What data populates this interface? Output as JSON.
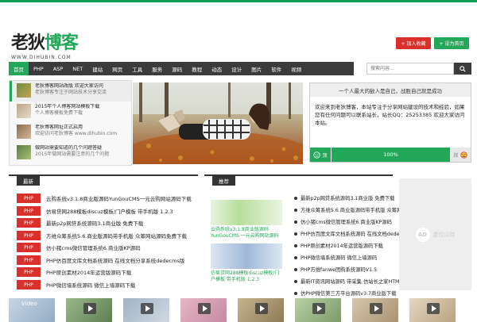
{
  "logo": {
    "chars": [
      "老",
      "狄",
      "博",
      "客"
    ],
    "sub": "WWW.DIHUBIN.COM"
  },
  "header_buttons": [
    {
      "label": "+ 加入收藏",
      "color": "#d9302c"
    },
    {
      "label": "+ 设为首页",
      "color": "#23a85a"
    }
  ],
  "nav": [
    "首页",
    "PHP",
    "ASP",
    "NET",
    "建站",
    "网页",
    "工具",
    "服务",
    "源码",
    "教程",
    "动态",
    "设计",
    "图片",
    "软件",
    "视频"
  ],
  "search": {
    "placeholder": "搜索内容..."
  },
  "featured": [
    {
      "title": "老狄博客网站改版 欢迎大家访问",
      "sub": "老狄博客专注于网站技术分享交流"
    },
    {
      "title": "2015年个人博客网站模板下载",
      "sub": "个人博客模板免费下载"
    },
    {
      "title": "老狄博客网址正式启用",
      "sub": "欢迎访问老狄博客 www.dihubin.com"
    },
    {
      "title": "做网站需要知道的几个问题答疑",
      "sub": "2015年做网站需要注意的几个问题"
    }
  ],
  "quote": {
    "title": "一个人最大的敌人是自己，战胜自己就是成功",
    "text": "欢迎来到老狄博客，本站专注于分享网站建设的技术和经验，如果您有任何问题可以联系站长，站长QQ：25253385  欢迎大家访问本站。",
    "left_icon": "smile-icon",
    "percent": "100%",
    "right_icon": "frown-icon",
    "left_label": "顶",
    "right_label": "踩"
  },
  "list1": {
    "heading": "最新",
    "tag": "PHP",
    "items": [
      "云购系统v3.1.8商业版源码YunGouCMS一元云购网站源码下载",
      "仿易贷网288模板discuz模板/门户模板 带手机版 1.2.3",
      "最新p2p网贷系统源码3.1商业版 免费下载",
      "方维众筹系统5.6.商业版源码带手机版 众筹网站源码免费下载",
      "仿小猪cms微信管理系统6.商业版KP源码",
      "PHP仿百度文库文档系统源码 在线文档分享系统dedecms版",
      "PHP原创素材2014年运营版源码下载",
      "PHP微信墙系统源码 微信上墙源码下载"
    ]
  },
  "list2": {
    "heading": "推荐",
    "cards": [
      {
        "caption": "云购系统v3.1.8商业版源码YunGouCMS 一元云购网站源码"
      },
      {
        "caption": "仿易贷网288模板discuz模板/门户模板 带手机版 1.2.3"
      }
    ],
    "items": [
      "最新p2p网贷系统源码3.1商业版 免费下载",
      "方维众筹系统5.6.商业版源码带手机版 众筹网站源码",
      "仿小猪cms微信管理系统6.商业版KP源码",
      "PHP仿百度文库文档系统源码 在线文档dedecms版",
      "PHP原创素材2014年运营版源码下载",
      "PHP微信墙系统源码 微信上墙源码",
      "PHP方维fanwe团购系统源码V1.5",
      "最新IT资讯网站源码 带采集 仿站长之家HTML版",
      "仿PHP微信第三方平台源码v3.7商业版下载"
    ]
  },
  "ad": {
    "badge": "AD",
    "text": "虚位以待"
  },
  "videos": [
    "video-1",
    "video-2",
    "video-3",
    "video-4",
    "video-5",
    "video-6",
    "video-7",
    "video-8"
  ],
  "video_label": "Video"
}
